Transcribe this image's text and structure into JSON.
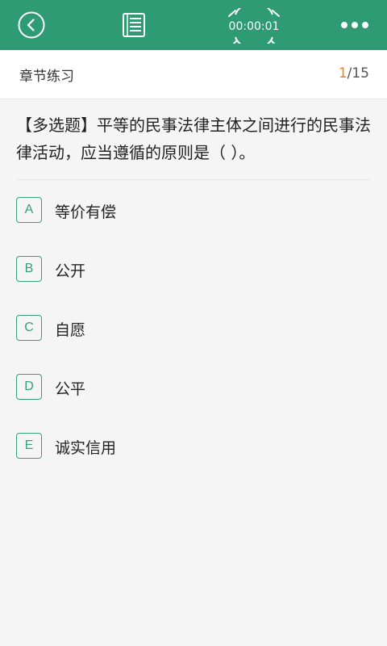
{
  "topbar": {
    "background": "#2e9b72",
    "back_icon": "chevron-left-circle-icon",
    "notes_icon": "notebook-icon",
    "timer_icon": "alarm-clock-icon",
    "timer": "00:00:01",
    "more_icon": "more-dots-icon"
  },
  "subheader": {
    "title": "章节练习",
    "current": "1",
    "total": "/15",
    "current_color": "#e08a1e"
  },
  "question": {
    "text": "【多选题】平等的民事法律主体之间进行的民事法律活动，应当遵循的原则是（ ）。"
  },
  "options": [
    {
      "letter": "A",
      "text": "等价有偿"
    },
    {
      "letter": "B",
      "text": "公开"
    },
    {
      "letter": "C",
      "text": "自愿"
    },
    {
      "letter": "D",
      "text": "公平"
    },
    {
      "letter": "E",
      "text": "诚实信用"
    }
  ],
  "accent_color": "#37a079"
}
